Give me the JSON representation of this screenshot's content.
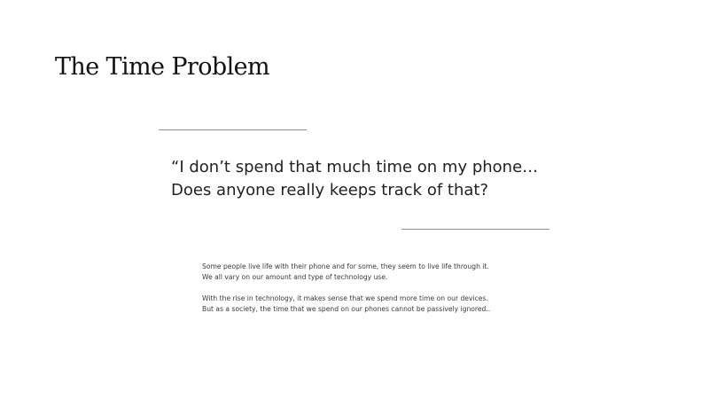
{
  "slide": {
    "title": "The Time Problem",
    "quote_lines": [
      "“I don’t spend that much time on my phone…",
      "Does anyone really keeps track of that?"
    ],
    "paragraphs": [
      {
        "lines": [
          "Some people live life with their phone and for some, they seem to live life through it.",
          "We all vary on our amount and type of technology use."
        ]
      },
      {
        "lines": [
          "With the rise in technology, it makes sense that we spend more time on our devices.",
          "But as a society, the time that we spend on our phones cannot be passively ignored.."
        ]
      }
    ]
  }
}
